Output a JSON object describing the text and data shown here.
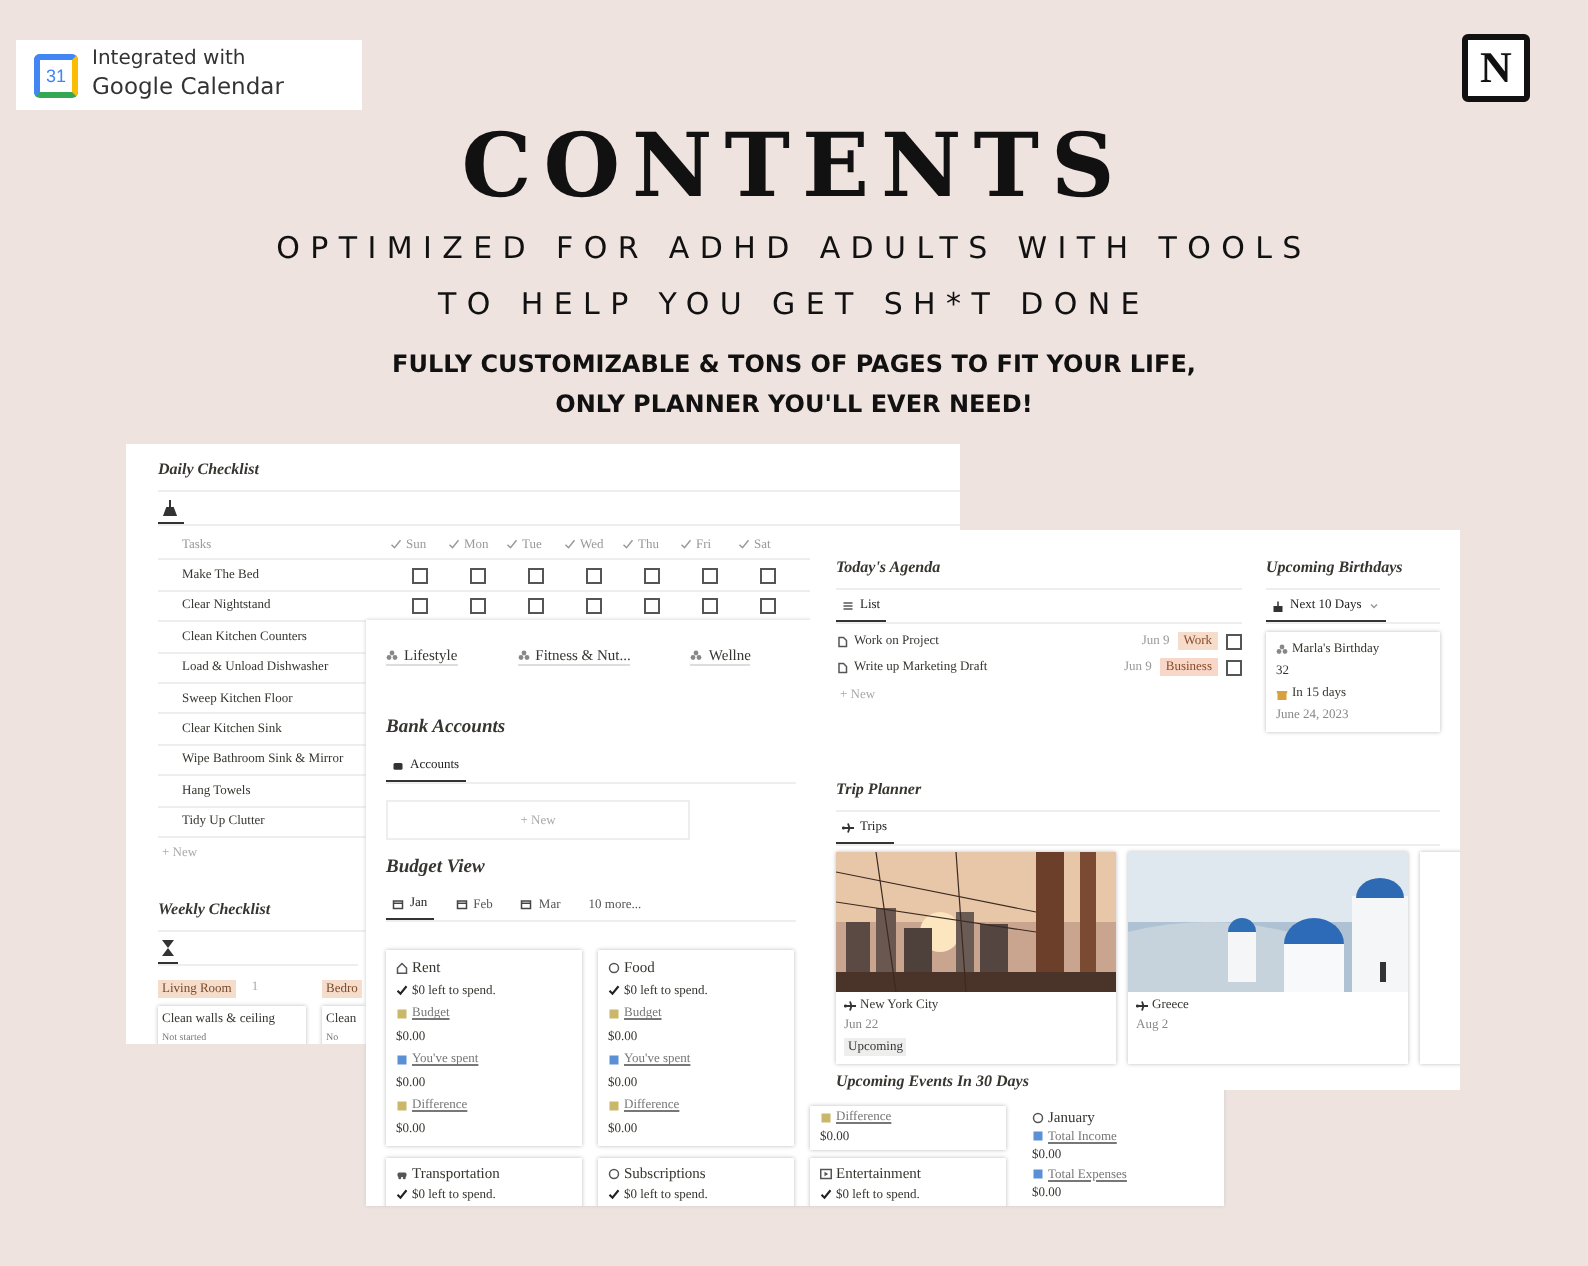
{
  "badge": {
    "logo_number": "31",
    "line1": "Integrated with",
    "line2": "Google Calendar"
  },
  "notion_logo": {
    "letter": "N"
  },
  "title": "CONTENTS",
  "subtitle_lines": [
    "OPTIMIZED FOR ADHD ADULTS WITH TOOLS",
    "TO HELP YOU GET SH*T DONE"
  ],
  "tagline_lines": [
    "FULLY CUSTOMIZABLE & TONS OF PAGES TO FIT YOUR LIFE,",
    "ONLY PLANNER YOU'LL EVER NEED!"
  ],
  "daily_checklist": {
    "title": "Daily Checklist",
    "columns": [
      "Tasks",
      "Sun",
      "Mon",
      "Tue",
      "Wed",
      "Thu",
      "Fri",
      "Sat"
    ],
    "rows": [
      {
        "task": "Make The Bed",
        "days": [
          {
            "checked": false
          },
          {
            "checked": false
          },
          {
            "checked": false
          },
          {
            "checked": false
          },
          {
            "checked": false
          },
          {
            "checked": false
          },
          {
            "checked": false
          }
        ]
      },
      {
        "task": "Clear Nightstand",
        "days": [
          {
            "checked": false
          },
          {
            "checked": false
          },
          {
            "checked": false
          },
          {
            "checked": false
          },
          {
            "checked": false
          },
          {
            "checked": false
          },
          {
            "checked": false
          }
        ]
      },
      {
        "task": "Clean Kitchen Counters"
      },
      {
        "task": "Load & Unload Dishwasher"
      },
      {
        "task": "Sweep Kitchen Floor"
      },
      {
        "task": "Clear Kitchen Sink"
      },
      {
        "task": "Wipe Bathroom Sink & Mirror"
      },
      {
        "task": "Hang Towels"
      },
      {
        "task": "Tidy Up Clutter"
      }
    ],
    "new_label": "+ New"
  },
  "weekly_checklist": {
    "title": "Weekly Checklist",
    "groups": [
      {
        "label": "Living Room",
        "count": "1",
        "color": "#f6dccb",
        "cards": [
          {
            "title": "Clean walls & ceiling",
            "status": "Not started"
          }
        ]
      },
      {
        "label": "Bedro",
        "color": "#f6dccb",
        "cards": [
          {
            "title": "Clean",
            "status": "No"
          }
        ]
      }
    ]
  },
  "dashboard": {
    "categories": [
      "Lifestyle",
      "Fitness & Nut...",
      "Wellne"
    ],
    "bank_accounts": {
      "title": "Bank Accounts",
      "tab": "Accounts",
      "new_label": "+ New"
    },
    "budget_view": {
      "title": "Budget View",
      "tabs": [
        {
          "label": "Jan",
          "selected": true
        },
        {
          "label": "Feb",
          "selected": false
        },
        {
          "label": "Mar",
          "selected": false
        }
      ],
      "more": "10 more...",
      "cards": [
        {
          "kind": "full",
          "name": "Rent",
          "status": "$0 left to spend.",
          "lines": [
            [
              "Budget",
              "$0.00"
            ],
            [
              "You've spent",
              "$0.00"
            ],
            [
              "Difference",
              "$0.00"
            ]
          ]
        },
        {
          "kind": "full",
          "name": "Food",
          "status": "$0 left to spend.",
          "lines": [
            [
              "Budget",
              "$0.00"
            ],
            [
              "You've spent",
              "$0.00"
            ],
            [
              "Difference",
              "$0.00"
            ]
          ]
        },
        {
          "kind": "tail",
          "lines": [
            [
              "Difference",
              "$0.00"
            ]
          ]
        },
        {
          "kind": "head",
          "name": "Transportation",
          "status": "$0 left to spend."
        },
        {
          "kind": "head",
          "name": "Subscriptions",
          "status": "$0 left to spend."
        },
        {
          "kind": "head",
          "name": "Entertainment",
          "status": "$0 left to spend."
        },
        {
          "kind": "month",
          "name": "January",
          "lines": [
            [
              "Total Income",
              "$0.00"
            ],
            [
              "Total Expenses",
              "$0.00"
            ]
          ]
        }
      ]
    }
  },
  "agenda": {
    "title": "Today's Agenda",
    "tab": "List",
    "items": [
      {
        "name": "Work on Project",
        "date": "Jun 9",
        "tag": "Work",
        "color": "#f6dccb",
        "checked": false
      },
      {
        "name": "Write up Marketing Draft",
        "date": "Jun 9",
        "tag": "Business",
        "color": "#f8d7c8",
        "checked": false
      }
    ],
    "new_label": "+ New"
  },
  "birthdays": {
    "title": "Upcoming Birthdays",
    "tab": "Next 10 Days",
    "card": {
      "name": "Marla's Birthday",
      "age": "32",
      "countdown": "In 15 days",
      "date": "June 24, 2023"
    }
  },
  "trip_planner": {
    "title": "Trip Planner",
    "tab": "Trips",
    "trips": [
      {
        "kind": "picture",
        "place": "New York City",
        "date": "Jun 22",
        "status": "Upcoming"
      },
      {
        "kind": "picture",
        "place": "Greece",
        "date": "Aug 2"
      }
    ]
  },
  "upcoming_events": {
    "title": "Upcoming Events In 30 Days"
  }
}
